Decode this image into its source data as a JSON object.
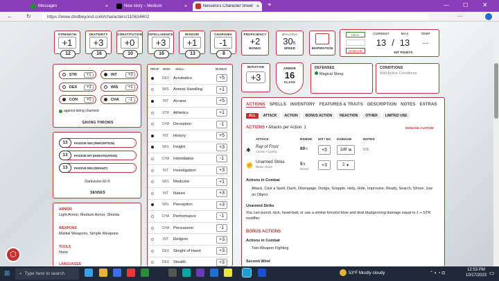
{
  "browser": {
    "tabs": [
      {
        "label": "Messages"
      },
      {
        "label": "New story – Medium"
      },
      {
        "label": "Nesvera's Character Sheet - D&D Beyond"
      }
    ],
    "new_tab": "+",
    "url": "https://www.dndbeyond.com/characters/110634402"
  },
  "abilities": [
    {
      "name": "STRENGTH",
      "mod": "+1",
      "score": "12"
    },
    {
      "name": "DEXTERITY",
      "mod": "+3",
      "score": "16"
    },
    {
      "name": "CONSTITUTION",
      "mod": "+0",
      "score": "10"
    },
    {
      "name": "INTELLIGENCE",
      "mod": "+3",
      "score": "16"
    },
    {
      "name": "WISDOM",
      "mod": "+1",
      "score": "13"
    },
    {
      "name": "CHARISMA",
      "mod": "-1",
      "score": "8"
    }
  ],
  "proficiency": {
    "label_top": "PROFICIENCY",
    "value": "+2",
    "label": "BONUS"
  },
  "walking": {
    "label_top": "WALKING",
    "value": "30",
    "unit": "ft.",
    "label": "SPEED"
  },
  "inspiration": {
    "label": "INSPIRATION"
  },
  "hp": {
    "heal": "HEAL",
    "damage": "DAMAGE",
    "current_label": "CURRENT",
    "max_label": "MAX",
    "temp_label": "TEMP",
    "current": "13",
    "sep": "/",
    "max": "13",
    "temp": "--",
    "label": "HIT POINTS"
  },
  "initiative": {
    "label": "INITIATIVE",
    "value": "+3"
  },
  "armor": {
    "label_top": "ARMOR",
    "value": "16",
    "label": "CLASS"
  },
  "defenses": {
    "title": "DEFENSES",
    "item": "Magical Sleep"
  },
  "conditions": {
    "title": "CONDITIONS",
    "placeholder": "Add Active Conditions"
  },
  "saves": {
    "rows": [
      {
        "ab": "STR",
        "bn": "+1",
        "prof": false
      },
      {
        "ab": "INT",
        "bn": "+3",
        "prof": true
      },
      {
        "ab": "DEX",
        "bn": "+3",
        "prof": false
      },
      {
        "ab": "WIS",
        "bn": "+1",
        "prof": false
      },
      {
        "ab": "CON",
        "bn": "+0",
        "prof": true
      },
      {
        "ab": "CHA",
        "bn": "-1",
        "prof": true
      }
    ],
    "note": "against being charmed",
    "title": "SAVING THROWS"
  },
  "senses": {
    "rows": [
      {
        "v": "13",
        "l": "PASSIVE WIS (PERCEPTION)"
      },
      {
        "v": "13",
        "l": "PASSIVE INT (INVESTIGATION)"
      },
      {
        "v": "13",
        "l": "PASSIVE WIS (INSIGHT)"
      }
    ],
    "dark": "Darkvision 60 ft.",
    "title": "SENSES"
  },
  "profs": {
    "armor_t": "ARMOR",
    "armor": "Light Armor, Medium Armor, Shields",
    "weapons_t": "WEAPONS",
    "weapons": "Martial Weapons, Simple Weapons",
    "tools_t": "TOOLS",
    "tools": "None",
    "lang_t": "LANGUAGES"
  },
  "skills": {
    "head": {
      "prof": "PROF",
      "mod": "MOD",
      "skill": "SKILL",
      "bonus": "BONUS"
    },
    "rows": [
      {
        "p": true,
        "ab": "DEX",
        "n": "Acrobatics",
        "b": "+5"
      },
      {
        "p": false,
        "ab": "WIS",
        "n": "Animal Handling",
        "b": "+1"
      },
      {
        "p": true,
        "ab": "INT",
        "n": "Arcana",
        "b": "+5"
      },
      {
        "p": false,
        "ab": "STR",
        "n": "Athletics",
        "b": "+1"
      },
      {
        "p": false,
        "ab": "CHA",
        "n": "Deception",
        "b": "-1"
      },
      {
        "p": true,
        "ab": "INT",
        "n": "History",
        "b": "+5"
      },
      {
        "p": true,
        "ab": "WIS",
        "n": "Insight",
        "b": "+3"
      },
      {
        "p": false,
        "ab": "CHA",
        "n": "Intimidation",
        "b": "-1"
      },
      {
        "p": false,
        "ab": "INT",
        "n": "Investigation",
        "b": "+3"
      },
      {
        "p": false,
        "ab": "WIS",
        "n": "Medicine",
        "b": "+1"
      },
      {
        "p": false,
        "ab": "INT",
        "n": "Nature",
        "b": "+3"
      },
      {
        "p": true,
        "ab": "WIS",
        "n": "Perception",
        "b": "+3"
      },
      {
        "p": false,
        "ab": "CHA",
        "n": "Performance",
        "b": "-1"
      },
      {
        "p": false,
        "ab": "CHA",
        "n": "Persuasion",
        "b": "-1"
      },
      {
        "p": false,
        "ab": "INT",
        "n": "Religion",
        "b": "+3"
      },
      {
        "p": false,
        "ab": "DEX",
        "n": "Sleight of Hand",
        "b": "+3"
      },
      {
        "p": false,
        "ab": "DEX",
        "n": "Stealth",
        "b": "+3"
      }
    ]
  },
  "actions": {
    "tabs": [
      "ACTIONS",
      "SPELLS",
      "INVENTORY",
      "FEATURES & TRAITS",
      "DESCRIPTION",
      "NOTES",
      "EXTRAS"
    ],
    "filters": [
      "ALL",
      "ATTACK",
      "ACTION",
      "BONUS ACTION",
      "REACTION",
      "OTHER",
      "LIMITED USE"
    ],
    "attacks_title": "ACTIONS",
    "attacks_per": "• Attacks per Action: 1",
    "manage": "MANAGE CUSTOM",
    "cols": {
      "attack": "ATTACK",
      "range": "RANGE",
      "hit": "HIT / DC",
      "damage": "DAMAGE",
      "notes": "NOTES"
    },
    "rows": [
      {
        "name": "Ray of Frost",
        "sub": "Cantrip • Cantrip",
        "range": "60",
        "range_unit": "ft.",
        "hit": "+5",
        "dmg": "1d8",
        "notes": "V/S"
      },
      {
        "name": "Unarmed Strike",
        "sub": "Melee Attack",
        "range": "5",
        "range_unit": "ft.",
        "range_sub": "Reach",
        "hit": "+3",
        "dmg": "2",
        "notes": ""
      }
    ],
    "combat_title": "Actions in Combat",
    "combat_text": "Attack, Cast a Spell, Dash, Disengage, Dodge, Grapple, Help, Hide, Improvise, Ready, Search, Shove, Use an Object",
    "unarmed_title": "Unarmed Strike",
    "unarmed_text": "You can punch, kick, head-butt, or use a similar forceful blow and deal bludgeoning damage equal to 1 + STR modifier",
    "bonus_title": "BONUS ACTIONS",
    "bonus_combat": "Actions in Combat",
    "bonus_text": "Two-Weapon Fighting",
    "second_wind": "Second Wind"
  },
  "taskbar": {
    "search": "Type here to search",
    "weather": "53°F  Mostly cloudy",
    "time": "12:53 PM",
    "date": "10/17/2023"
  }
}
